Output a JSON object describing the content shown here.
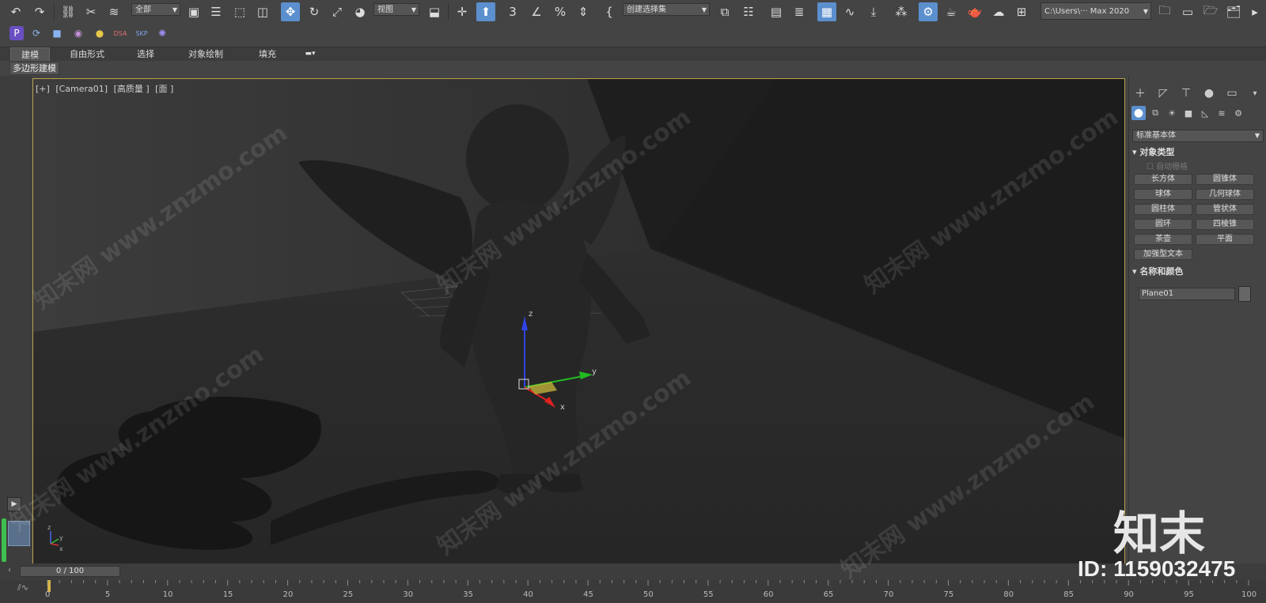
{
  "toolbar": {
    "filter_dropdown": "全部",
    "ref_coord_dropdown": "视图",
    "named_selection_dropdown": "创建选择集",
    "project_path": "C:\\Users\\··· Max 2020"
  },
  "ribbon": {
    "tabs": [
      {
        "label": "建模",
        "active": true
      },
      {
        "label": "自由形式",
        "active": false
      },
      {
        "label": "选择",
        "active": false
      },
      {
        "label": "对象绘制",
        "active": false
      },
      {
        "label": "填充",
        "active": false
      }
    ],
    "sub_label": "多边形建模"
  },
  "viewport": {
    "label_plus": "[+]",
    "label_camera": "[Camera01]",
    "label_quality": "[高质量 ]",
    "label_shading": "[面 ]",
    "gizmo_axes": {
      "x": "x",
      "y": "y",
      "z": "z"
    },
    "corner_axes": {
      "x": "x",
      "y": "y",
      "z": "z"
    }
  },
  "command_panel": {
    "category_dropdown": "标准基本体",
    "object_type_title": "对象类型",
    "auto_grid": "自动栅格",
    "primitives": [
      "长方体",
      "圆锥体",
      "球体",
      "几何球体",
      "圆柱体",
      "管状体",
      "圆环",
      "四棱锥",
      "茶壶",
      "平面",
      "加强型文本"
    ],
    "name_color_title": "名称和颜色",
    "object_name": "Plane01"
  },
  "timeline": {
    "slider_text": "0 / 100",
    "ticks": [
      "0",
      "5",
      "10",
      "15",
      "20",
      "25",
      "30",
      "35",
      "40",
      "45",
      "50",
      "55",
      "60",
      "65",
      "70",
      "75",
      "80",
      "85",
      "90",
      "95",
      "100"
    ]
  },
  "watermark": {
    "brand": "知末",
    "id": "ID: 1159032475",
    "site": "知末网 www.znzmo.com"
  },
  "colors": {
    "accent": "#5b8fce",
    "viewport_border": "#b8a14a",
    "background": "#444444"
  }
}
